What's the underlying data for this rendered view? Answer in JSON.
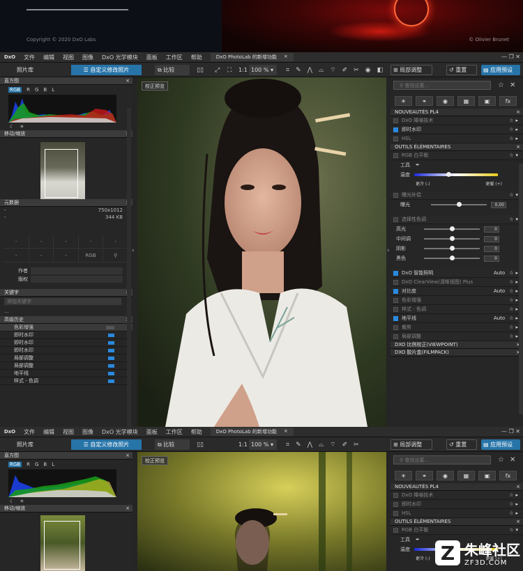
{
  "splash": {
    "copyright": "Copyright © 2020 DxO Labs",
    "credit": "© Olivier Brunet"
  },
  "menubar": {
    "logo": "DxO",
    "items": [
      "文件",
      "编辑",
      "视图",
      "图像",
      "DxO 光学模块",
      "面板",
      "工作区",
      "帮助"
    ],
    "tab": "DxO PhotoLab 的新增功能",
    "tab_close": "×",
    "window_buttons": "— ❐ ✕"
  },
  "toolbar": {
    "library": "照片库",
    "customize": "自定义修改照片",
    "compare": "比较",
    "zoom_11": "1:1",
    "zoom_value": "100 %",
    "local_adjust": "局部调整",
    "reset": "重置",
    "apply_preset": "应用预设"
  },
  "left": {
    "histogram": {
      "title": "直方图",
      "tabs": [
        "RGB",
        "R",
        "G",
        "B",
        "L"
      ],
      "selected_tab": "RGB"
    },
    "navigator": {
      "title": "移动/缩放"
    },
    "metadata": {
      "title": "元数据",
      "dimensions": "750x1012",
      "size": "344 KB",
      "dash": "-",
      "rgb": "RGB",
      "author_label": "作者",
      "copyright_label": "版权"
    },
    "keywords": {
      "title": "关键字",
      "placeholder": "添加关键字",
      "dots": "..."
    },
    "history": {
      "title": "高级历史",
      "items": [
        "色彩增强",
        "即时水印",
        "即时水印",
        "即时水印",
        "局部调整",
        "局部调整",
        "地平线",
        "样式 - 色调"
      ]
    }
  },
  "photo": {
    "correction_preview": "校正预览"
  },
  "right": {
    "search_placeholder": "查找设置...",
    "tool_icons": [
      "☀",
      "⚭",
      "◉",
      "▦",
      "▣",
      "fx"
    ],
    "section1": "NOUVEAUTÉS PL4",
    "s1_items": [
      "DxO 降噪技术",
      "即时水印",
      "HSL"
    ],
    "section2": "OUTILS ÉLÉMENTAIRES",
    "wb": {
      "title": "RGB 白平衡",
      "tool": "工具",
      "temp": "温度",
      "cooler": "更冷 (-)",
      "warmer": "更暖 (+)"
    },
    "exposure": {
      "title": "曝光补偿",
      "label": "曝光",
      "value": "0,00"
    },
    "selective": {
      "title": "选择性色调",
      "rows": [
        {
          "label": "高光",
          "value": "0"
        },
        {
          "label": "中间调",
          "value": "0"
        },
        {
          "label": "阴影",
          "value": "0"
        },
        {
          "label": "黑色",
          "value": "0"
        }
      ]
    },
    "lower_items": [
      {
        "label": "DxO 智能照明",
        "auto": "Auto",
        "on": true
      },
      {
        "label": "DxO ClearView(清晰视图) Plus",
        "auto": "",
        "on": false
      },
      {
        "label": "对比度",
        "auto": "Auto",
        "on": true
      },
      {
        "label": "色彩增强",
        "auto": "",
        "on": false
      },
      {
        "label": "样式 - 色调",
        "auto": "",
        "on": false
      },
      {
        "label": "地平线",
        "auto": "Auto",
        "on": true
      },
      {
        "label": "裁剪",
        "auto": "",
        "on": false
      },
      {
        "label": "局部调整",
        "auto": "",
        "on": false
      }
    ],
    "viewpoint": "DXO 比例校正(VIEWPOINT)",
    "filmpack": "DXO 胶片盒(FILMPACK)"
  },
  "watermark": {
    "glyph": "Z",
    "title": "朱峰社区",
    "sub": "ZF3D.COM"
  },
  "colors": {
    "accent": "#2774a8",
    "panel": "#262626"
  }
}
